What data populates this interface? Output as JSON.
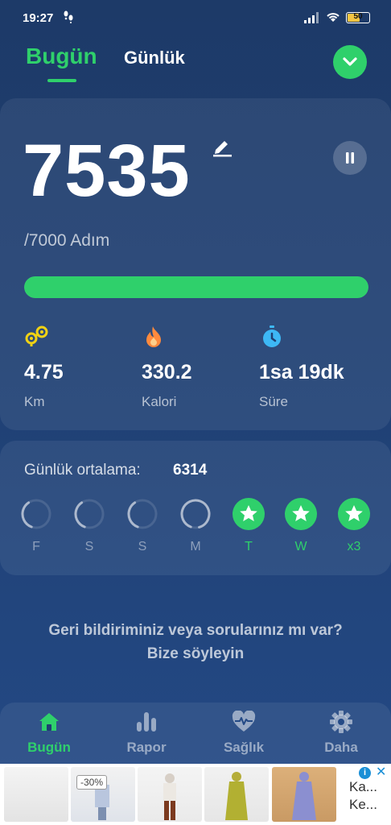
{
  "status_bar": {
    "time": "19:27",
    "battery": "50"
  },
  "tabs": {
    "active": "Bugün",
    "other": "Günlük"
  },
  "today": {
    "steps": "7535",
    "goal_text": "/7000 Adım",
    "progress_fraction": 1.0,
    "stats": [
      {
        "value": "4.75",
        "label": "Km",
        "icon": "distance-icon"
      },
      {
        "value": "330.2",
        "label": "Kalori",
        "icon": "fire-icon"
      },
      {
        "value": "1sa 19dk",
        "label": "Süre",
        "icon": "clock-icon"
      }
    ]
  },
  "daily_average": {
    "label": "Günlük ortalama:",
    "value": "6314",
    "days": [
      {
        "label": "F",
        "done": false,
        "progress": 0.35
      },
      {
        "label": "S",
        "done": false,
        "progress": 0.35
      },
      {
        "label": "S",
        "done": false,
        "progress": 0.35
      },
      {
        "label": "M",
        "done": false,
        "progress": 0.9
      },
      {
        "label": "T",
        "done": true
      },
      {
        "label": "W",
        "done": true
      },
      {
        "label": "x3",
        "done": true
      }
    ]
  },
  "feedback": {
    "line1": "Geri bildiriminiz veya sorularınız mı var?",
    "line2": "Bize söyleyin"
  },
  "nav": [
    {
      "label": "Bugün",
      "icon": "home-icon",
      "active": true
    },
    {
      "label": "Rapor",
      "icon": "bar-chart-icon",
      "active": false
    },
    {
      "label": "Sağlık",
      "icon": "heart-pulse-icon",
      "active": false
    },
    {
      "label": "Daha",
      "icon": "gear-icon",
      "active": false
    }
  ],
  "ad": {
    "discount": "-30%",
    "text1": "Ka...",
    "text2": "Ke..."
  },
  "colors": {
    "accent": "#2fd06b",
    "background": "#1f3f72",
    "distance_icon": "#f0d214",
    "fire_icon": "#ff8a3d",
    "clock_icon": "#3db8f5"
  }
}
